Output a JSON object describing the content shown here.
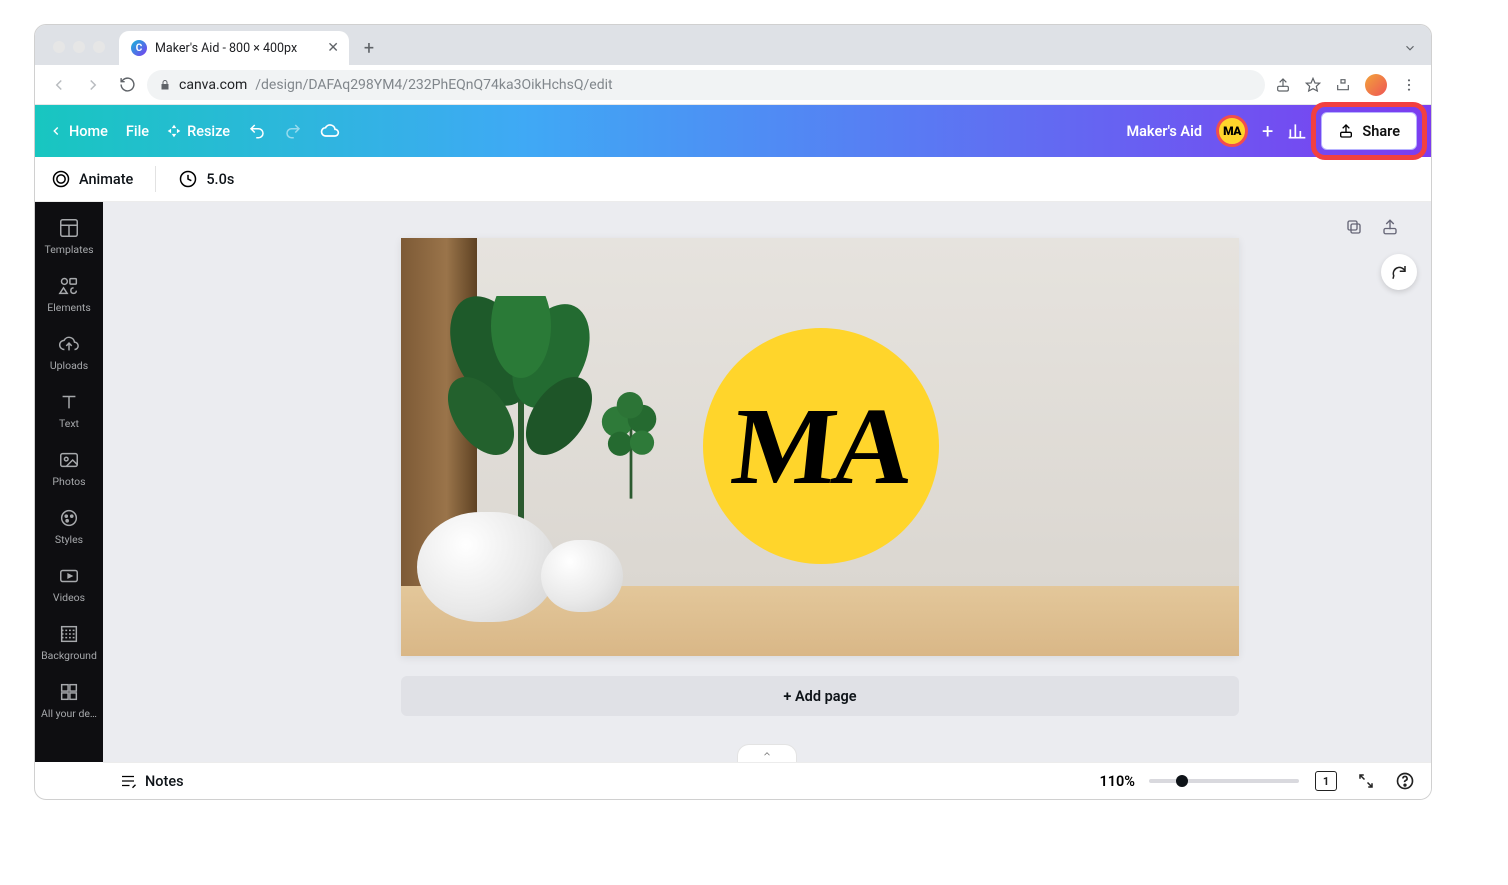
{
  "browser": {
    "tab_title": "Maker's Aid - 800 × 400px",
    "url_domain": "canva.com",
    "url_path": "/design/DAFAq298YM4/232PhEQnQ74ka3OikHchsQ/edit"
  },
  "header": {
    "home": "Home",
    "file": "File",
    "resize": "Resize",
    "doc_title": "Maker's Aid",
    "share": "Share",
    "avatar_text": "MA"
  },
  "context_bar": {
    "animate": "Animate",
    "duration": "5.0s"
  },
  "sidebar": {
    "items": [
      {
        "label": "Templates",
        "icon": "templates"
      },
      {
        "label": "Elements",
        "icon": "elements"
      },
      {
        "label": "Uploads",
        "icon": "uploads"
      },
      {
        "label": "Text",
        "icon": "text"
      },
      {
        "label": "Photos",
        "icon": "photos"
      },
      {
        "label": "Styles",
        "icon": "styles"
      },
      {
        "label": "Videos",
        "icon": "videos"
      },
      {
        "label": "Background",
        "icon": "background"
      },
      {
        "label": "All your de…",
        "icon": "all-designs"
      }
    ]
  },
  "canvas": {
    "logo_text": "MA",
    "add_page": "+ Add page"
  },
  "footer": {
    "notes": "Notes",
    "zoom": "110%",
    "page_indicator": "1"
  }
}
